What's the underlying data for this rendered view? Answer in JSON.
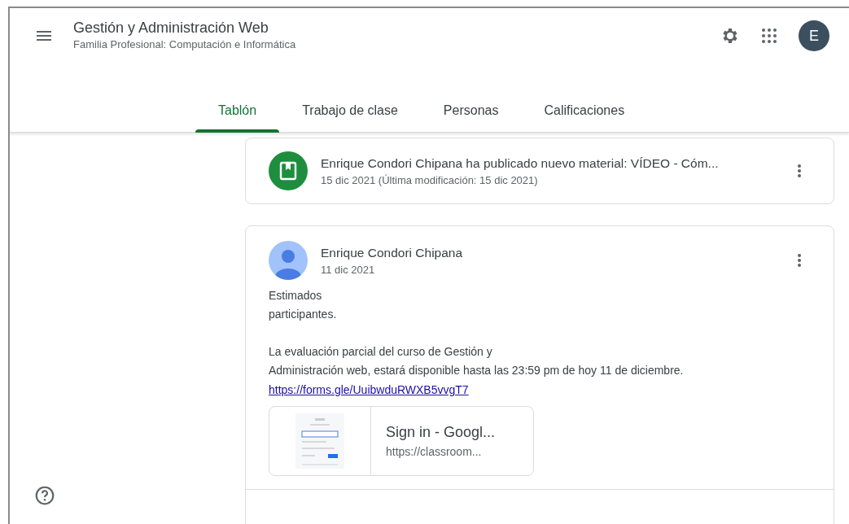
{
  "header": {
    "title": "Gestión y Administración Web",
    "subtitle": "Familia Profesional: Computación e Informática",
    "avatar_letter": "E"
  },
  "tabs": [
    {
      "label": "Tablón",
      "selected": true
    },
    {
      "label": "Trabajo de clase",
      "selected": false
    },
    {
      "label": "Personas",
      "selected": false
    },
    {
      "label": "Calificaciones",
      "selected": false
    }
  ],
  "posts": [
    {
      "kind": "material",
      "title": "Enrique Condori Chipana ha publicado nuevo material: VÍDEO - Cóm...",
      "date": "15 dic 2021 (Última modificación: 15 dic 2021)"
    },
    {
      "kind": "announcement",
      "author": "Enrique Condori Chipana",
      "date": "11 dic 2021",
      "paragraphs": [
        [
          "Estimados",
          "participantes."
        ],
        [
          "La evaluación parcial del curso de Gestión y",
          "Administración web, estará disponible hasta las 23:59 pm de hoy 11 de diciembre."
        ]
      ],
      "link": "https://forms.gle/UuibwduRWXB5vvgT7",
      "attachment": {
        "title": "Sign in - Googl...",
        "url": "https://classroom..."
      }
    }
  ]
}
